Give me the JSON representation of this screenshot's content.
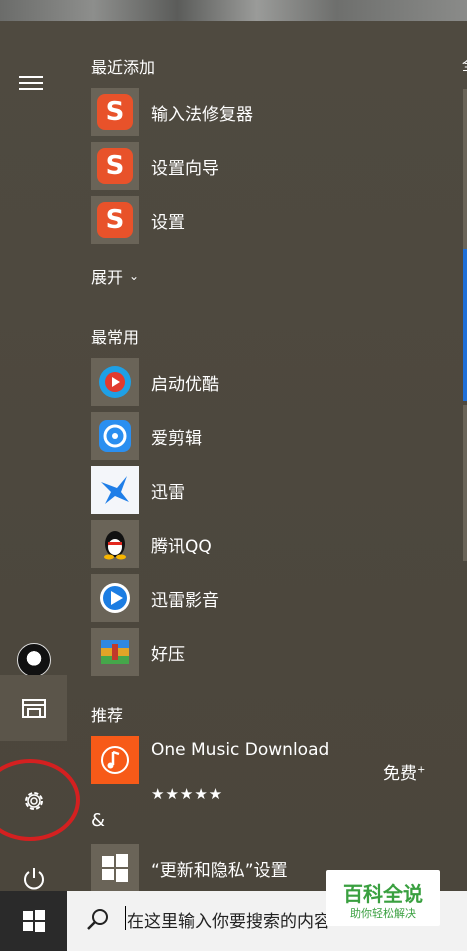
{
  "start_menu": {
    "sections": {
      "recently_added": "最近添加",
      "expand": "展开",
      "most_used": "最常用",
      "suggested": "推荐",
      "symbol_group": "&"
    },
    "recently_added_apps": [
      {
        "label": "输入法修复器",
        "icon": "sogou-s-icon"
      },
      {
        "label": "设置向导",
        "icon": "sogou-s-icon"
      },
      {
        "label": "设置",
        "icon": "sogou-s-icon"
      }
    ],
    "most_used_apps": [
      {
        "label": "启动优酷",
        "icon": "youku-icon"
      },
      {
        "label": "爱剪辑",
        "icon": "aijianji-icon"
      },
      {
        "label": "迅雷",
        "icon": "xunlei-bird-icon"
      },
      {
        "label": "腾讯QQ",
        "icon": "qq-penguin-icon"
      },
      {
        "label": "迅雷影音",
        "icon": "xunlei-player-icon"
      },
      {
        "label": "好压",
        "icon": "haozip-icon"
      }
    ],
    "suggested_app": {
      "label": "One Music Download",
      "price": "免费",
      "price_mark": "+",
      "stars": "★★★★★",
      "icon": "music-note-icon"
    },
    "settings_app": {
      "label": "“更新和隐私”设置",
      "icon": "windows-logo-icon"
    },
    "edge_partial_text": "全"
  },
  "taskbar": {
    "search_text": "在这里输入你要搜索的内容"
  },
  "watermark": {
    "title": "百科全说",
    "subtitle": "助你轻松解决"
  },
  "colors": {
    "annotation_circle": "#d42020",
    "tile_accent_blue": "#1e6fd9",
    "suggested_tile": "#f75a18"
  }
}
